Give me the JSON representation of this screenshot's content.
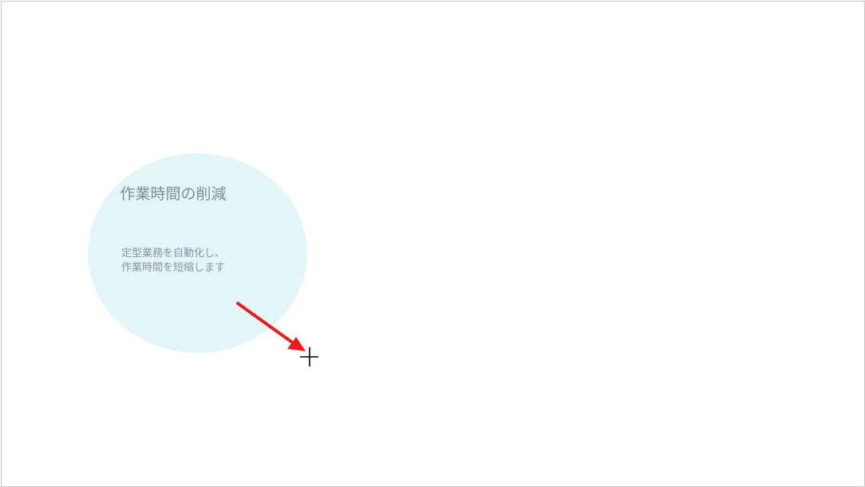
{
  "slide": {
    "bubble": {
      "title": "作業時間の削減",
      "body": "定型業務を自動化し、作業時間を短縮します",
      "fill_color": "#e3f5f7",
      "text_color": "#7f8d99"
    }
  },
  "annotation": {
    "icon": "arrow-icon",
    "color": "#e81c1c"
  },
  "cursor": {
    "icon": "crosshair-cursor-icon",
    "color": "#000000"
  }
}
